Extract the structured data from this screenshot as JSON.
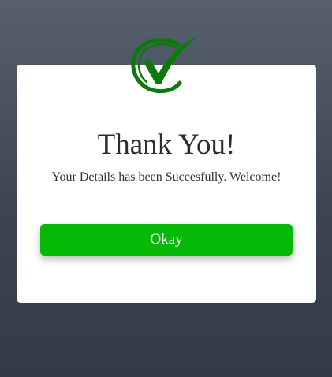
{
  "dialog": {
    "icon": "check-mark-icon",
    "title": "Thank You!",
    "message": "Your Details has been Succesfully. Welcome!",
    "button_label": "Okay"
  },
  "colors": {
    "background": "#3b4652",
    "card": "#ffffff",
    "check": "#0b7a0b",
    "button": "#06b906",
    "button_text": "#ffffff"
  }
}
